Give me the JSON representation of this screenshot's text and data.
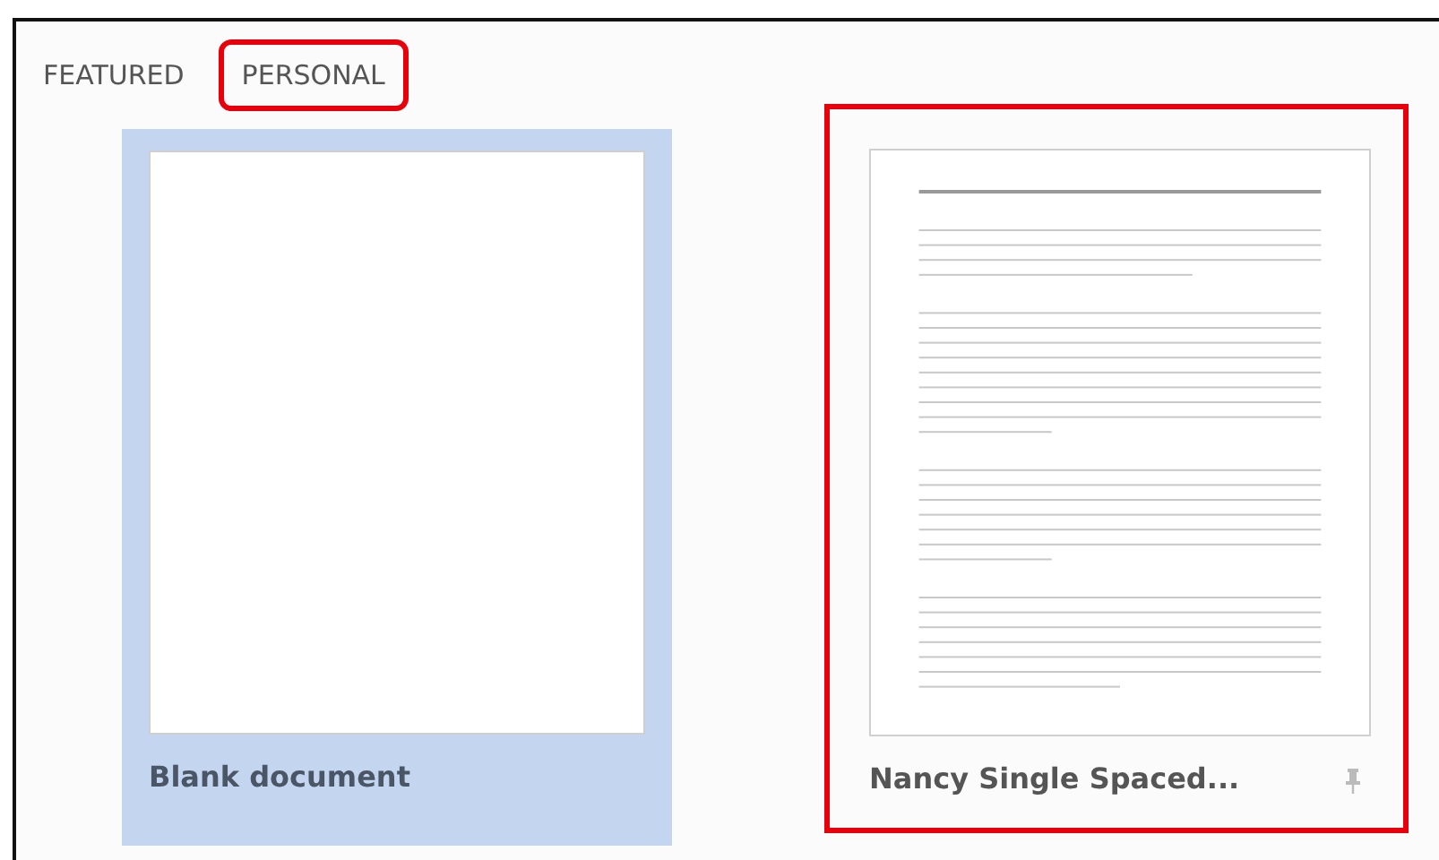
{
  "tabs": [
    {
      "label": "FEATURED",
      "highlighted": false
    },
    {
      "label": "PERSONAL",
      "highlighted": true
    }
  ],
  "templates": [
    {
      "title": "Blank document",
      "kind": "blank",
      "selected": true,
      "highlighted": false,
      "pin_button": false
    },
    {
      "title": "Nancy Single Spaced...",
      "kind": "document",
      "selected": false,
      "highlighted": true,
      "pin_button": true
    }
  ]
}
